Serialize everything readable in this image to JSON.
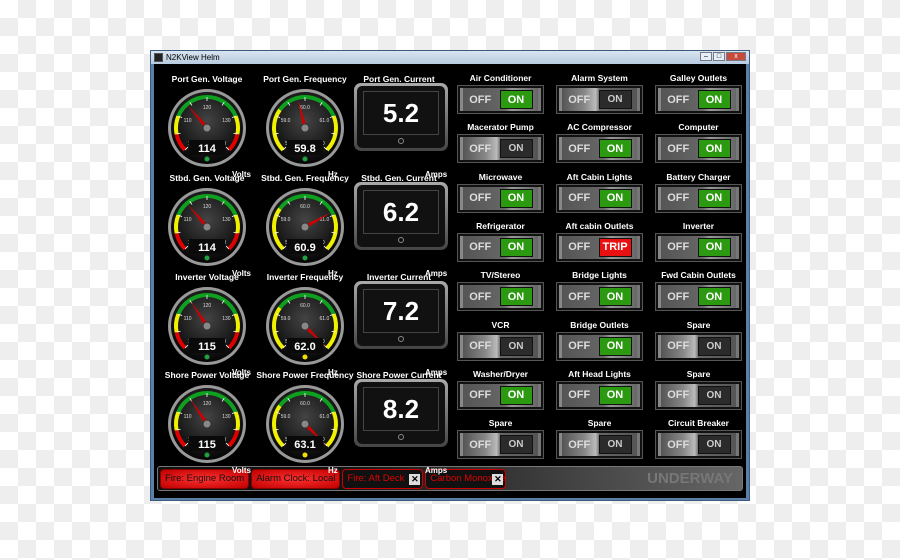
{
  "window": {
    "title": "N2KView Helm",
    "minimize": "–",
    "maximize": "□",
    "close": "x"
  },
  "gauges": [
    {
      "title": "Port Gen. Voltage",
      "kind": "voltage",
      "min": 100,
      "max": 140,
      "ticks": [
        "100",
        "110",
        "120",
        "130",
        "140"
      ],
      "value": 114,
      "display": "114",
      "unit": "Volts",
      "indicator": "#20a040"
    },
    {
      "title": "Port Gen. Frequency",
      "kind": "frequency",
      "min": 58,
      "max": 62,
      "ticks": [
        "58.0",
        "59.0",
        "60.0",
        "61.0",
        "62.0"
      ],
      "value": 59.8,
      "display": "59.8",
      "unit": "Hz",
      "indicator": "#20a040"
    },
    {
      "title": "Stbd. Gen. Voltage",
      "kind": "voltage",
      "min": 100,
      "max": 140,
      "ticks": [
        "100",
        "110",
        "120",
        "130",
        "140"
      ],
      "value": 114,
      "display": "114",
      "unit": "Volts",
      "indicator": "#20a040"
    },
    {
      "title": "Stbd. Gen. Frequency",
      "kind": "frequency",
      "min": 58,
      "max": 62,
      "ticks": [
        "58.0",
        "59.0",
        "60.0",
        "61.0",
        "62.0"
      ],
      "value": 60.9,
      "display": "60.9",
      "unit": "Hz",
      "indicator": "#20a040"
    },
    {
      "title": "Inverter Voltage",
      "kind": "voltage",
      "min": 100,
      "max": 140,
      "ticks": [
        "100",
        "110",
        "120",
        "130",
        "140"
      ],
      "value": 115,
      "display": "115",
      "unit": "Volts",
      "indicator": "#20a040"
    },
    {
      "title": "Inverter Frequency",
      "kind": "frequency",
      "min": 58,
      "max": 62,
      "ticks": [
        "58.0",
        "59.0",
        "60.0",
        "61.0",
        "62.0"
      ],
      "value": 62.0,
      "display": "62.0",
      "unit": "Hz",
      "indicator": "#f0e000"
    },
    {
      "title": "Shore Power Voltage",
      "kind": "voltage",
      "min": 100,
      "max": 140,
      "ticks": [
        "100",
        "110",
        "120",
        "130",
        "140"
      ],
      "value": 115,
      "display": "115",
      "unit": "Volts",
      "indicator": "#20a040"
    },
    {
      "title": "Shore Power Frequency",
      "kind": "frequency",
      "min": 58,
      "max": 62,
      "ticks": [
        "58.0",
        "59.0",
        "60.0",
        "61.0",
        "62.0"
      ],
      "value": 63.1,
      "display": "63.1",
      "unit": "Hz",
      "indicator": "#f0e000"
    }
  ],
  "currents": [
    {
      "title": "Port Gen. Current",
      "value": "5.2",
      "unit": "Amps"
    },
    {
      "title": "Stbd. Gen. Current",
      "value": "6.2",
      "unit": "Amps"
    },
    {
      "title": "Inverter Current",
      "value": "7.2",
      "unit": "Amps"
    },
    {
      "title": "Shore Power Current",
      "value": "8.2",
      "unit": "Amps"
    }
  ],
  "switches": [
    {
      "label": "Air Conditioner",
      "state": "on",
      "off_text": "OFF",
      "on_text": "ON"
    },
    {
      "label": "Alarm System",
      "state": "off",
      "off_text": "OFF",
      "on_text": "ON"
    },
    {
      "label": "Galley Outlets",
      "state": "on",
      "off_text": "OFF",
      "on_text": "ON"
    },
    {
      "label": "Macerator Pump",
      "state": "off",
      "off_text": "OFF",
      "on_text": "ON"
    },
    {
      "label": "AC Compressor",
      "state": "on",
      "off_text": "OFF",
      "on_text": "ON"
    },
    {
      "label": "Computer",
      "state": "on",
      "off_text": "OFF",
      "on_text": "ON"
    },
    {
      "label": "Microwave",
      "state": "on",
      "off_text": "OFF",
      "on_text": "ON"
    },
    {
      "label": "Aft Cabin Lights",
      "state": "on",
      "off_text": "OFF",
      "on_text": "ON"
    },
    {
      "label": "Battery Charger",
      "state": "on",
      "off_text": "OFF",
      "on_text": "ON"
    },
    {
      "label": "Refrigerator",
      "state": "on",
      "off_text": "OFF",
      "on_text": "ON"
    },
    {
      "label": "Aft cabin Outlets",
      "state": "trip",
      "off_text": "OFF",
      "on_text": "TRIP"
    },
    {
      "label": "Inverter",
      "state": "on",
      "off_text": "OFF",
      "on_text": "ON"
    },
    {
      "label": "TV/Stereo",
      "state": "on",
      "off_text": "OFF",
      "on_text": "ON"
    },
    {
      "label": "Bridge Lights",
      "state": "on",
      "off_text": "OFF",
      "on_text": "ON"
    },
    {
      "label": "Fwd Cabin Outlets",
      "state": "on",
      "off_text": "OFF",
      "on_text": "ON"
    },
    {
      "label": "VCR",
      "state": "off",
      "off_text": "OFF",
      "on_text": "ON"
    },
    {
      "label": "Bridge Outlets",
      "state": "on",
      "off_text": "OFF",
      "on_text": "ON"
    },
    {
      "label": "Spare",
      "state": "off",
      "off_text": "OFF",
      "on_text": "ON"
    },
    {
      "label": "Washer/Dryer",
      "state": "on",
      "off_text": "OFF",
      "on_text": "ON"
    },
    {
      "label": "Aft Head Lights",
      "state": "on",
      "off_text": "OFF",
      "on_text": "ON"
    },
    {
      "label": "Spare",
      "state": "off",
      "off_text": "OFF",
      "on_text": "ON"
    },
    {
      "label": "Spare",
      "state": "off",
      "off_text": "OFF",
      "on_text": "ON"
    },
    {
      "label": "Spare",
      "state": "off",
      "off_text": "OFF",
      "on_text": "ON"
    },
    {
      "label": "Circuit Breaker",
      "state": "off",
      "off_text": "OFF",
      "on_text": "ON"
    }
  ],
  "alarms": [
    {
      "text": "Fire: Engine Room",
      "status": "active"
    },
    {
      "text": "Alarm Clock: Local",
      "status": "active"
    },
    {
      "text": "Fire: Aft Deck",
      "status": "acknowledged",
      "close": "✕"
    },
    {
      "text": "Carbon Monoxide",
      "status": "acknowledged",
      "close": "✕"
    }
  ],
  "mode": "UNDERWAY",
  "colors": {
    "on": "#2c9a10",
    "trip": "#e81010",
    "alarm": "#ff2020",
    "gauge_green": "#10a020",
    "gauge_yellow": "#f0f000",
    "gauge_red": "#e00000"
  }
}
